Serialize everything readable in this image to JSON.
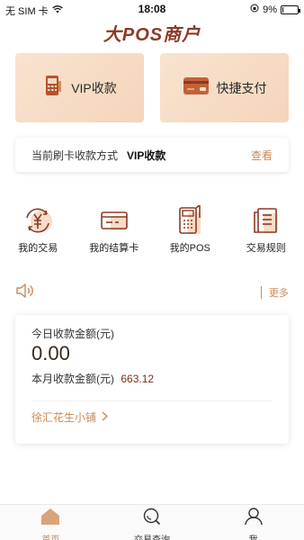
{
  "status_bar": {
    "carrier": "无 SIM 卡",
    "time": "18:08",
    "battery": "9%",
    "battery_level": 0.09
  },
  "header": {
    "logo_text": "大POS商户"
  },
  "top_cards": [
    {
      "label": "VIP收款",
      "icon": "pos-terminal-icon"
    },
    {
      "label": "快捷支付",
      "icon": "credit-card-icon"
    }
  ],
  "mode_bar": {
    "label": "当前刷卡收款方式",
    "value": "VIP收款",
    "link": "查看"
  },
  "functions": [
    {
      "label": "我的交易",
      "icon": "yuan-cycle-icon"
    },
    {
      "label": "我的结算卡",
      "icon": "bank-card-icon"
    },
    {
      "label": "我的POS",
      "icon": "pos-machine-icon"
    },
    {
      "label": "交易规则",
      "icon": "document-icon"
    }
  ],
  "notice": {
    "icon": "speaker-icon",
    "more_label": "更多"
  },
  "earnings": {
    "today_label": "今日收款金额(元)",
    "today_value": "0.00",
    "month_label": "本月收款金额(元)",
    "month_value": "663.12",
    "shop_name": "徐汇花生小铺"
  },
  "tabs": [
    {
      "label": "首页",
      "icon": "home-icon",
      "active": true
    },
    {
      "label": "交易查询",
      "icon": "search-icon",
      "active": false
    },
    {
      "label": "我",
      "icon": "user-icon",
      "active": false
    }
  ],
  "colors": {
    "accent": "#c98a55",
    "brand": "#8b3a24",
    "card_bg": "#f6dcc5"
  }
}
